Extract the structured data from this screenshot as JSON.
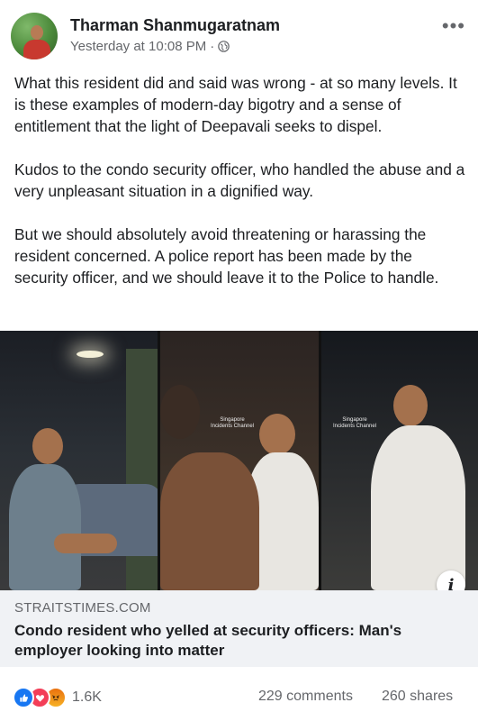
{
  "post": {
    "author": "Tharman Shanmugaratnam",
    "timestamp": "Yesterday at 10:08 PM",
    "separator": "·",
    "privacy_icon": "globe-icon",
    "more_icon": "•••",
    "paragraphs": [
      "What this resident did and said was wrong -  at so many levels. It is these examples of modern-day bigotry and a sense of entitlement that the light of Deepavali seeks to dispel.",
      "Kudos to the condo security officer, who handled the abuse and a very unpleasant situation in a dignified way.",
      "But we should absolutely avoid threatening or harassing the resident concerned. A police report has been made by the security officer, and we should leave it to the Police to handle."
    ]
  },
  "media": {
    "watermark": "Singapore Incidents Channel",
    "info_icon": "i"
  },
  "link_preview": {
    "domain": "STRAITSTIMES.COM",
    "title": "Condo resident who yelled at security officers: Man's employer looking into matter"
  },
  "engagement": {
    "reaction_icons": [
      "like-icon",
      "love-icon",
      "angry-icon"
    ],
    "reaction_count": "1.6K",
    "comments": "229 comments",
    "shares": "260 shares"
  },
  "colors": {
    "like": "#1877f2",
    "love": "#f33e58",
    "angry": "#e9710f",
    "link_card_bg": "#f0f2f5",
    "secondary_text": "#65676b"
  }
}
